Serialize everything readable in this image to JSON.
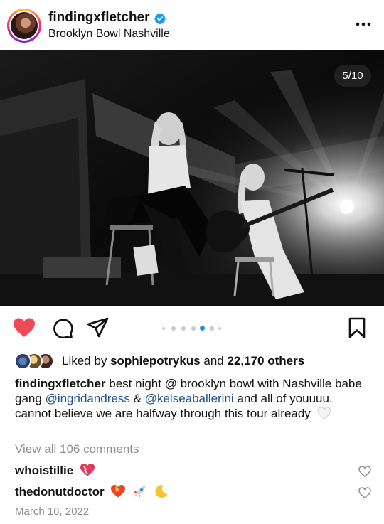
{
  "header": {
    "username": "findingxfletcher",
    "location": "Brooklyn Bowl Nashville",
    "verified": true
  },
  "photo": {
    "counter": "5/10",
    "current_index": 4,
    "total_dots": 7
  },
  "actions": {
    "liked": true,
    "icons": [
      "heart-icon",
      "comment-icon",
      "share-icon",
      "bookmark-icon"
    ]
  },
  "likes": {
    "prefix": "Liked by",
    "user": "sophiepotrykus",
    "connector": "and",
    "others": "22,170 others"
  },
  "caption": {
    "username": "findingxfletcher",
    "text_1": "best night @ brooklyn bowl with Nashville babe gang",
    "mention_1": "@ingridandress",
    "amp": "&",
    "mention_2": "@kelseaballerini",
    "text_2": "and all of youuuu. cannot believe we are halfway through this tour already"
  },
  "view_comments": "View all 106 comments",
  "comments": [
    {
      "username": "whoistillie"
    },
    {
      "username": "thedonutdoctor"
    }
  ],
  "date": "March 16, 2022",
  "colors": {
    "like_red": "#ed4956",
    "mention_blue": "#1f4d8c",
    "muted_gray": "#8e8e8e",
    "active_dot": "#1b8fe6"
  }
}
